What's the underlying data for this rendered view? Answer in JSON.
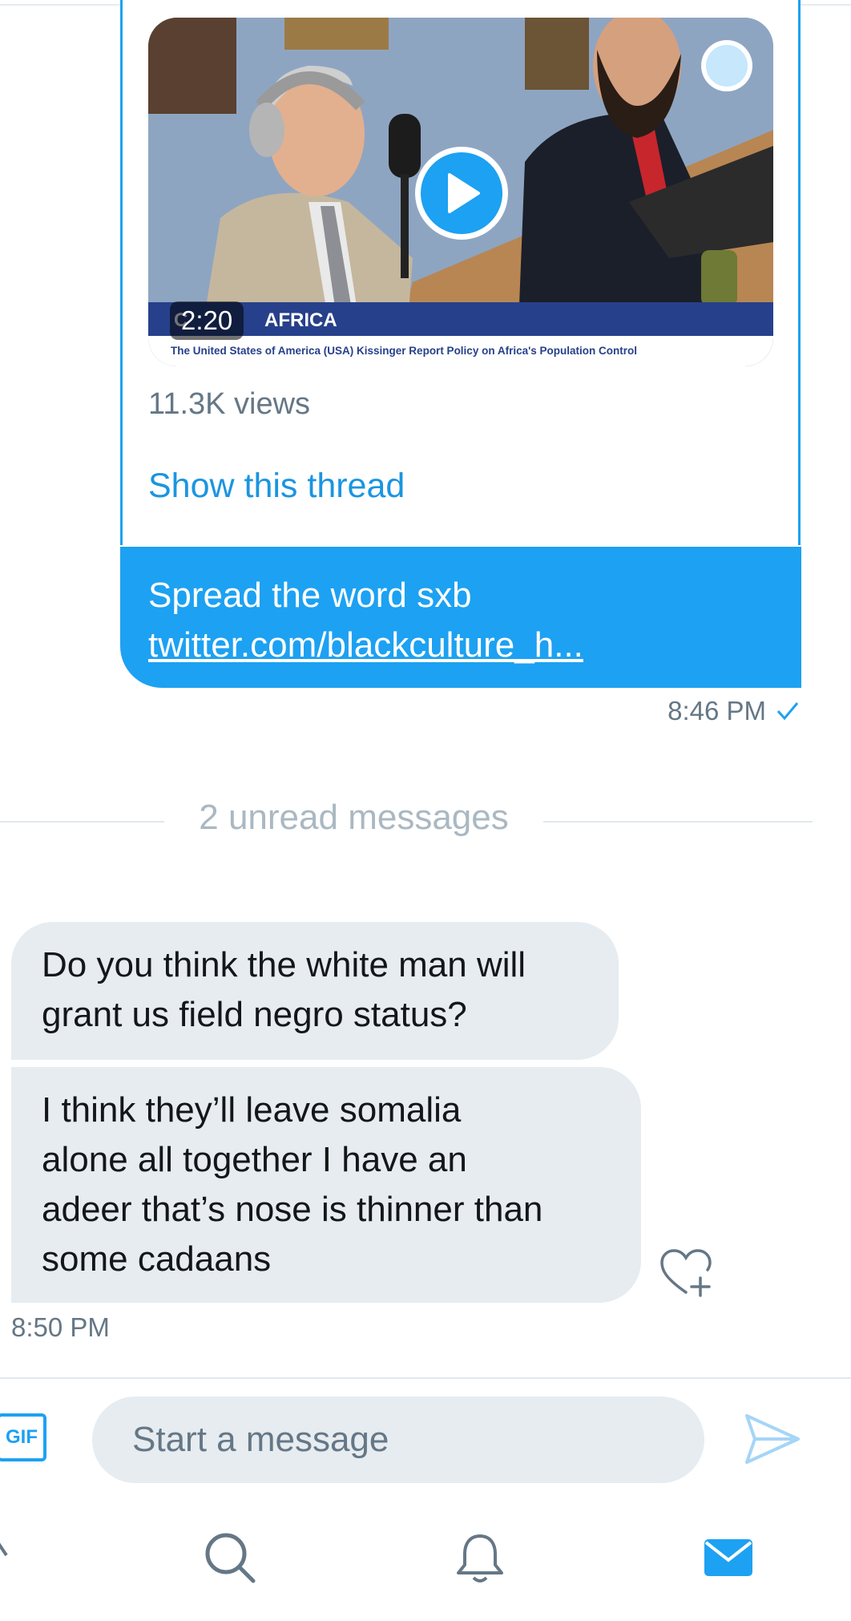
{
  "shared_tweet": {
    "video_banner": "AFRICA",
    "video_banner_prefix": "C",
    "video_caption": "The United States of America (USA) Kissinger Report Policy on Africa's Population Control",
    "duration": "2:20",
    "views": "11.3K views",
    "show_thread": "Show this thread"
  },
  "sent_message": {
    "text": "Spread the word sxb",
    "link": "twitter.com/blackculture_h...",
    "time": "8:46 PM",
    "status_icon": "checkmark-icon"
  },
  "unread_divider": "2 unread messages",
  "received_messages": [
    {
      "lines": [
        "Do you think the white man will",
        "grant us field negro status?"
      ]
    },
    {
      "lines": [
        "I think they’ll leave somalia",
        "alone all together I have an",
        "adeer that’s nose is thinner than",
        "some cadaans"
      ]
    }
  ],
  "received_time": "8:50 PM",
  "composer": {
    "gif_label": "GIF",
    "placeholder": "Start a message"
  },
  "tabs": [
    "home-icon",
    "search-icon",
    "bell-icon",
    "mail-icon"
  ],
  "colors": {
    "accent": "#1da1f2",
    "bubble_received": "#e6ecf0",
    "muted_text": "#657786"
  }
}
